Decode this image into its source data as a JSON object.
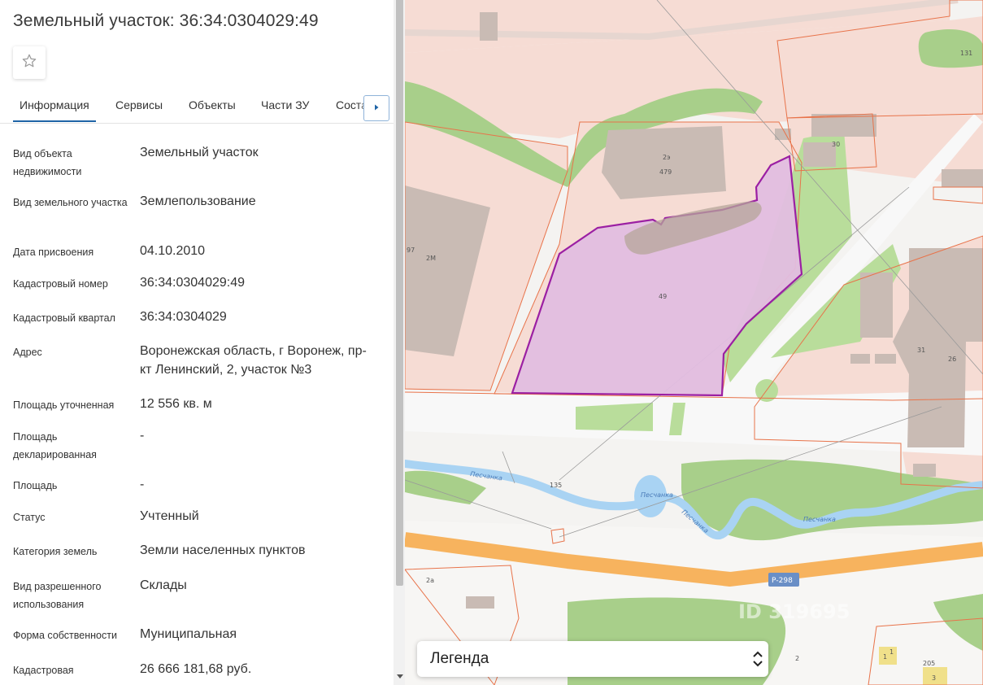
{
  "parcel": {
    "title": "Земельный участок: 36:34:0304029:49"
  },
  "tabs": [
    {
      "label": "Информация",
      "active": true
    },
    {
      "label": "Сервисы",
      "active": false
    },
    {
      "label": "Объекты",
      "active": false
    },
    {
      "label": "Части ЗУ",
      "active": false
    },
    {
      "label": "Состав ЗУ",
      "active": false
    }
  ],
  "info": [
    {
      "label": "Вид объекта недвижимости",
      "value": "Земельный участок"
    },
    {
      "label": "Вид земельного участка",
      "value": "Землепользование"
    },
    {
      "label": "Дата присвоения",
      "value": "04.10.2010"
    },
    {
      "label": "Кадастровый номер",
      "value": "36:34:0304029:49"
    },
    {
      "label": "Кадастровый квартал",
      "value": "36:34:0304029"
    },
    {
      "label": "Адрес",
      "value": "Воронежская область, г Воронеж, пр-кт Ленинский, 2, участок №3"
    },
    {
      "label": "Площадь уточненная",
      "value": "12 556 кв. м"
    },
    {
      "label": "Площадь декларированная",
      "value": "-"
    },
    {
      "label": "Площадь",
      "value": "-"
    },
    {
      "label": "Статус",
      "value": "Учтенный"
    },
    {
      "label": "Категория земель",
      "value": "Земли населенных пунктов"
    },
    {
      "label": "Вид разрешенного использования",
      "value": "Склады"
    },
    {
      "label": "Форма собственности",
      "value": "Муниципальная"
    },
    {
      "label": "Кадастровая",
      "value": "26 666 181,68 руб."
    }
  ],
  "map": {
    "labels": {
      "parcel_number": "49",
      "building_479": "479",
      "building_2e": "2э",
      "building_2m": "2М",
      "building_97": "97",
      "house_30": "30",
      "house_131": "131",
      "house_31": "31",
      "house_26": "26",
      "house_135": "135",
      "house_2a": "2а",
      "house_2": "2",
      "house_1": "1",
      "house_205": "205",
      "house_3": "3",
      "river_1": "Песчанка",
      "river_2": "Песчанка",
      "river_3": "Песчанка",
      "river_4": "Песчанка",
      "road_shield": "Р-298",
      "watermark": "ID 319695"
    },
    "colors": {
      "parcel_fill": "#e2bde0",
      "parcel_stroke": "#9b1fa3",
      "cadastral_line": "#e8734a",
      "land_pink": "#f6dcd4",
      "greenery": "#a8cf8a",
      "water": "#a9d3f3",
      "highway": "#f7b35e",
      "building": "#c9bbb4"
    }
  },
  "legend": {
    "label": "Легенда"
  }
}
